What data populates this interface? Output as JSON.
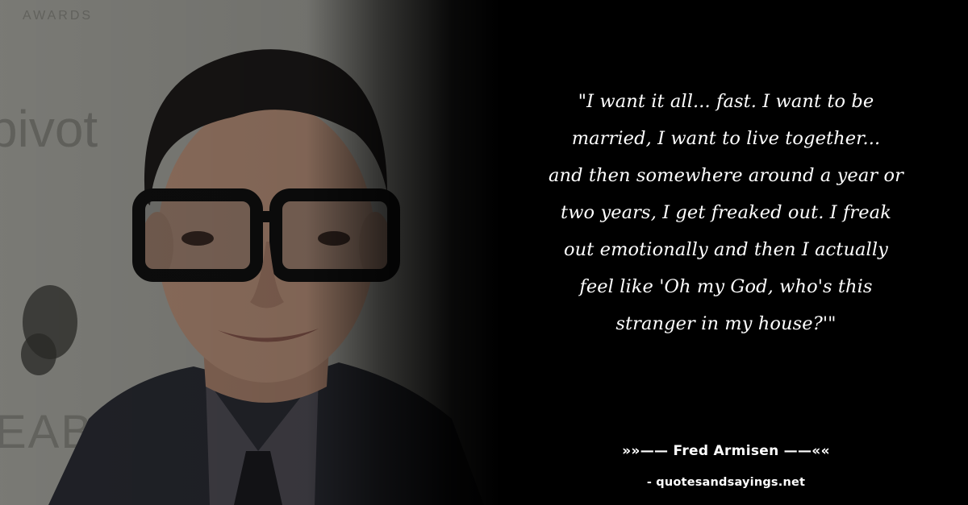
{
  "quote": {
    "lines": [
      "\"I want it all... fast. I want to be",
      "married, I want to live together...",
      "and then somewhere around a year or",
      "two years, I get freaked out. I freak",
      "out emotionally and then I actually",
      "feel like 'Oh my God, who's this",
      "stranger in my house?'\""
    ]
  },
  "attribution": {
    "author_line": "»»—— Fred Armisen ——««",
    "source": "- quotesandsayings.net"
  },
  "background_signage": {
    "top_text": "AWARDS",
    "left_text": "pivot",
    "lower_text": "EABODY"
  },
  "colors": {
    "background": "#000000",
    "text": "#ffffff",
    "photo_backdrop": "#b7b7b0"
  }
}
